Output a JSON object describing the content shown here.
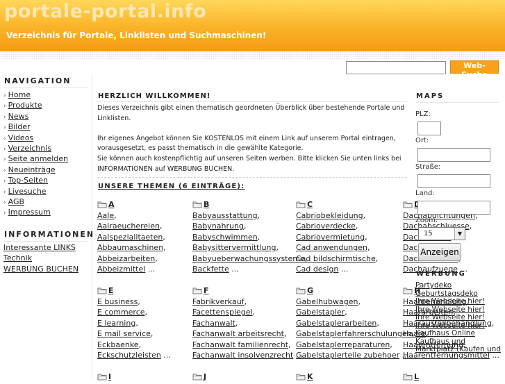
{
  "header": {
    "title": "portale-portal.info",
    "subtitle": "Verzeichnis für Portale, Linklisten und Suchmaschinen!"
  },
  "search": {
    "button": "Web-Suche",
    "value": ""
  },
  "navigation": {
    "title": "NAVIGATION",
    "items": [
      "Home",
      "Produkte",
      "News",
      "Bilder",
      "Videos",
      "Verzeichnis",
      "Seite anmelden",
      "Neueinträge",
      "Top-Seiten",
      "Livesuche",
      "AGB",
      "Impressum"
    ]
  },
  "informationen": {
    "title": "INFORMATIONEN",
    "items": [
      "Interessante LINKS",
      "Technik",
      "WERBUNG BUCHEN"
    ]
  },
  "main": {
    "welcome_title": "HERZLICH WILLKOMMEN!",
    "intro1": "Dieses Verzeichnis gibt einen thematisch geordneten Überblick über bestehende Portale und Linklisten.",
    "intro2": "Ihr eigenes Angebot können Sie KOSTENLOS mit einem Link auf unserem Portal eintragen, vorausgesetzt, es passt thematisch in die gewählte Kategorie.",
    "intro3": "Sie können auch kostenpflichtig auf unseren Seiten werben. Bitte klicken Sie unten links bei INFORMATIONEN auf WERBUNG BUCHEN.",
    "themes_title": "UNSERE THEMEN (6 EINTRÄGE):",
    "categories": [
      {
        "letter": "A",
        "items": [
          "Aale",
          "Aalraeuchereien",
          "Aalspezialitaeten",
          "Abbaumaschinen",
          "Abbeizarbeiten",
          "Abbeizmittel"
        ]
      },
      {
        "letter": "B",
        "items": [
          "Babyausstattung",
          "Babynahrung",
          "Babyschwimmen",
          "Babysittervermittlung",
          "Babyueberwachungssysteme",
          "Backfette"
        ]
      },
      {
        "letter": "C",
        "items": [
          "Cabriobekleidung",
          "Cabrioverdecke",
          "Cabriovermietung",
          "Cad anwendungen",
          "Cad bildschirmtische",
          "Cad design"
        ]
      },
      {
        "letter": "D",
        "items": [
          "Dachabdichtungen",
          "Dachabschluesse",
          "Dachabläufe",
          "Dachantennen",
          "Dachaufsetzer",
          "Dachaufzuege"
        ]
      },
      {
        "letter": "E",
        "items": [
          "E business",
          "E commerce",
          "E learning",
          "E mail service",
          "Eckbaenke",
          "Eckschutzleisten"
        ]
      },
      {
        "letter": "F",
        "items": [
          "Fabrikverkauf",
          "Facettenspiegel",
          "Fachanwalt",
          "Fachanwalt arbeitsrecht",
          "Fachanwalt familienrecht",
          "Fachanwalt insolvenzrecht"
        ]
      },
      {
        "letter": "G",
        "items": [
          "Gabelhubwagen",
          "Gabelstapler",
          "Gabelstaplerarbeiten",
          "Gabelstaplerfahrerschulungen",
          "Gabelstaplerreparaturen",
          "Gabelstaplerteile zubehoer"
        ]
      },
      {
        "letter": "H",
        "items": [
          "Haarbehandlung",
          "Haararbeiten",
          "Haarausfallbehandlung",
          "Haare",
          "Haarentfernung",
          "Haarentfernungsmittel"
        ]
      },
      {
        "letter": "I",
        "items": []
      },
      {
        "letter": "J",
        "items": []
      },
      {
        "letter": "K",
        "items": []
      },
      {
        "letter": "L",
        "items": []
      }
    ],
    "more": "..."
  },
  "maps": {
    "title": "MAPS",
    "plz_label": "PLZ:",
    "ort_label": "Ort:",
    "strasse_label": "Straße:",
    "land_label": "Land:",
    "zoom_label": "Zoom:",
    "zoom_value": "15",
    "show_button": "Anzeigen"
  },
  "werbung": {
    "title": "WERBUNG",
    "ads": [
      "Partydeko",
      "Geburtstagsdeko",
      "Ihre Webseite hier!",
      "Ihre Webseite hier!",
      "Ihre Webseite hier!",
      "Ihre Webseite hier!",
      "Kaufhaus Online",
      "Kaufhaus und",
      "Marktplatz (Kaufen und"
    ]
  }
}
